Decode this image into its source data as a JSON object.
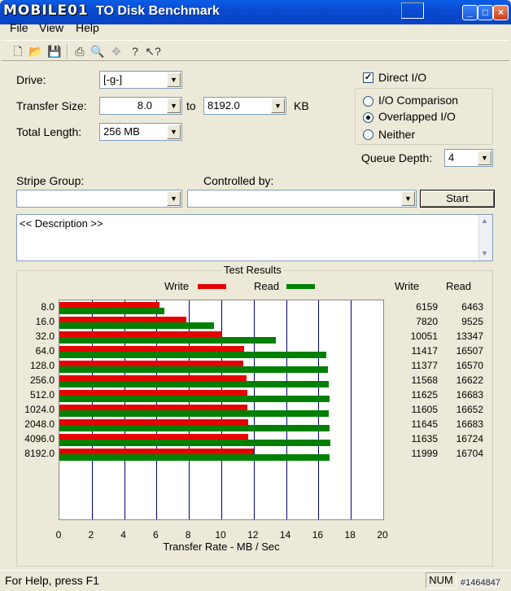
{
  "window": {
    "watermark": "MOBILE01",
    "title_visible": "TO Disk Benchmark",
    "buttons": [
      "_",
      "□",
      "×"
    ]
  },
  "menu": [
    "File",
    "View",
    "Help"
  ],
  "toolbar_icons": [
    "new-icon",
    "open-icon",
    "save-icon",
    "print-icon",
    "print-preview-icon",
    "move-icon",
    "help-icon",
    "context-help-icon"
  ],
  "form": {
    "drive_label": "Drive:",
    "drive_value": "[-g-]",
    "transfer_size_label": "Transfer Size:",
    "transfer_from": "8.0",
    "to_label": "to",
    "transfer_to": "8192.0",
    "kb_label": "KB",
    "total_length_label": "Total Length:",
    "total_length_value": "256 MB",
    "stripe_group_label": "Stripe Group:",
    "stripe_group_value": "",
    "controlled_by_label": "Controlled by:",
    "controlled_by_value": "",
    "start_label": "Start",
    "description": "<< Description >>"
  },
  "options": {
    "direct_io_label": "Direct I/O",
    "direct_io_checked": true,
    "radios": [
      {
        "label": "I/O Comparison",
        "selected": false
      },
      {
        "label": "Overlapped I/O",
        "selected": true
      },
      {
        "label": "Neither",
        "selected": false
      }
    ],
    "queue_depth_label": "Queue Depth:",
    "queue_depth_value": "4"
  },
  "results": {
    "title": "Test Results",
    "legend_write": "Write",
    "legend_read": "Read",
    "col_write": "Write",
    "col_read": "Read"
  },
  "chart_data": {
    "type": "bar",
    "orientation": "horizontal",
    "categories": [
      "8.0",
      "16.0",
      "32.0",
      "64.0",
      "128.0",
      "256.0",
      "512.0",
      "1024.0",
      "2048.0",
      "4096.0",
      "8192.0"
    ],
    "series": [
      {
        "name": "Write",
        "color": "#e60000",
        "values": [
          6159,
          7820,
          10051,
          11417,
          11377,
          11568,
          11625,
          11605,
          11645,
          11635,
          11999
        ]
      },
      {
        "name": "Read",
        "color": "#008000",
        "values": [
          6463,
          9525,
          13347,
          16507,
          16570,
          16622,
          16683,
          16652,
          16683,
          16724,
          16704
        ]
      }
    ],
    "x_ticks": [
      "0",
      "2",
      "4",
      "6",
      "8",
      "10",
      "12",
      "14",
      "16",
      "18",
      "20"
    ],
    "xlim": [
      0,
      20
    ],
    "xlabel": "Transfer Rate - MB / Sec",
    "legend": "top"
  },
  "status": {
    "help_text": "For Help, press F1",
    "num": "NUM",
    "corner_tag": "#1464847"
  }
}
